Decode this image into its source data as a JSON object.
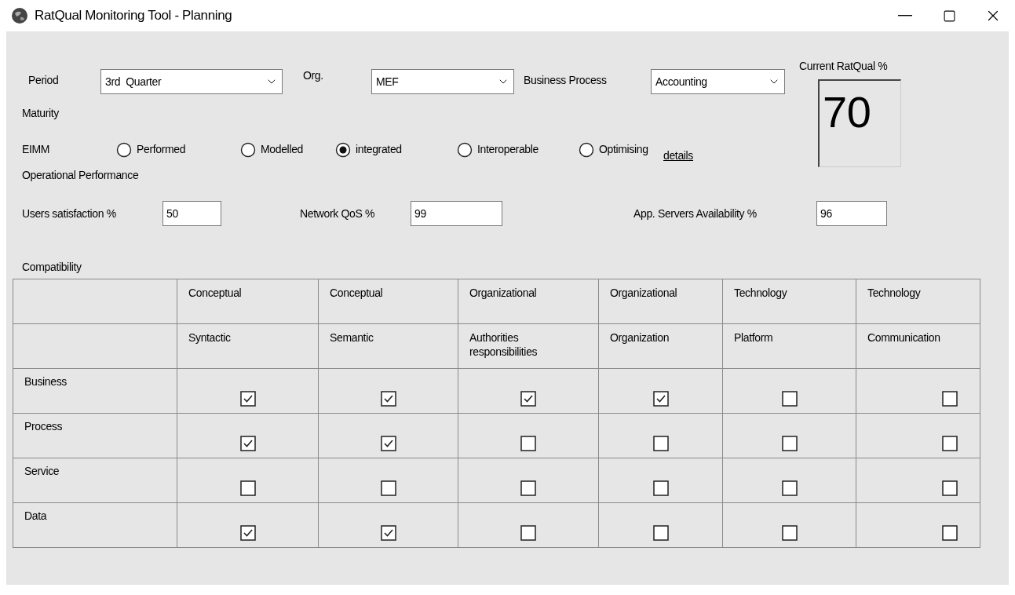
{
  "window": {
    "title": "RatQual Monitoring Tool - Planning"
  },
  "filters": [
    {
      "label": "Period",
      "value": "3rd  Quarter"
    },
    {
      "label": "Org.",
      "value": "MEF"
    },
    {
      "label": "Business Process",
      "value": "Accounting"
    }
  ],
  "ratqual": {
    "label": "Current RatQual %",
    "value": "70"
  },
  "maturity": {
    "heading": "Maturity",
    "scale_label": "EIMM",
    "details_link": "details",
    "options": [
      {
        "label": "Performed",
        "selected": false
      },
      {
        "label": "Modelled",
        "selected": false
      },
      {
        "label": "integrated",
        "selected": true
      },
      {
        "label": "Interoperable",
        "selected": false
      },
      {
        "label": "Optimising",
        "selected": false
      }
    ]
  },
  "operational_performance": {
    "heading": "Operational Performance",
    "metrics": [
      {
        "label": "Users satisfaction %",
        "value": "50"
      },
      {
        "label": "Network QoS %",
        "value": "99"
      },
      {
        "label": "App. Servers Availability %",
        "value": "96"
      }
    ]
  },
  "compatibility": {
    "heading": "Compatibility",
    "header_rows": [
      [
        "Conceptual",
        "Conceptual",
        "Organizational",
        "Organizational",
        "Technology",
        "Technology"
      ],
      [
        "Syntactic",
        "Semantic",
        "Authorities responsibilities",
        "Organization",
        "Platform",
        "Communication"
      ]
    ],
    "rows": [
      {
        "label": "Business",
        "cells": [
          {
            "checked": true
          },
          {
            "checked": true
          },
          {
            "checked": true
          },
          {
            "checked": true
          },
          {
            "checked": false
          },
          {
            "checked": false
          }
        ]
      },
      {
        "label": "Process",
        "cells": [
          {
            "checked": true
          },
          {
            "checked": true
          },
          {
            "checked": false
          },
          {
            "checked": false
          },
          {
            "checked": false
          },
          {
            "checked": false
          }
        ]
      },
      {
        "label": "Service",
        "cells": [
          {
            "checked": false
          },
          {
            "checked": false
          },
          {
            "checked": false
          },
          {
            "checked": false
          },
          {
            "checked": false
          },
          {
            "checked": false
          }
        ]
      },
      {
        "label": "Data",
        "cells": [
          {
            "checked": true
          },
          {
            "checked": true
          },
          {
            "checked": false
          },
          {
            "checked": false
          },
          {
            "checked": false
          },
          {
            "checked": false
          }
        ]
      }
    ]
  }
}
